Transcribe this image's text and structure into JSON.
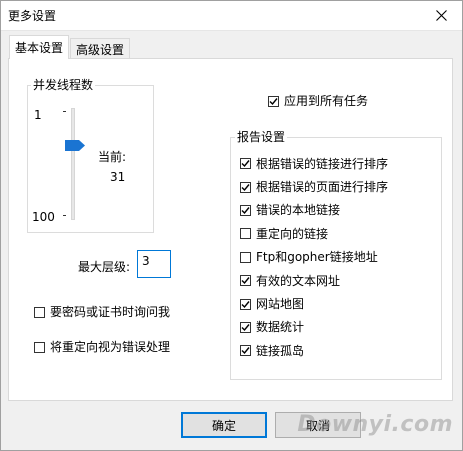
{
  "window": {
    "title": "更多设置"
  },
  "tabs": [
    {
      "label": "基本设置",
      "active": true
    },
    {
      "label": "高级设置",
      "active": false
    }
  ],
  "threads": {
    "group_label": "并发线程数",
    "min_label": "1",
    "max_label": "100",
    "current_label": "当前:",
    "current_value": "31"
  },
  "max_depth": {
    "label": "最大层级:",
    "value": "3"
  },
  "left_options": [
    {
      "label": "要密码或证书时询问我",
      "checked": false
    },
    {
      "label": "将重定向视为错误处理",
      "checked": false
    }
  ],
  "apply_all": {
    "label": "应用到所有任务",
    "checked": true
  },
  "report": {
    "group_label": "报告设置",
    "items": [
      {
        "label": "根据错误的链接进行排序",
        "checked": true
      },
      {
        "label": "根据错误的页面进行排序",
        "checked": true
      },
      {
        "label": "错误的本地链接",
        "checked": true
      },
      {
        "label": "重定向的链接",
        "checked": false
      },
      {
        "label": "Ftp和gopher链接地址",
        "checked": false
      },
      {
        "label": "有效的文本网址",
        "checked": true
      },
      {
        "label": "网站地图",
        "checked": true
      },
      {
        "label": "数据统计",
        "checked": true
      },
      {
        "label": "链接孤岛",
        "checked": true
      }
    ]
  },
  "buttons": {
    "ok": "确定",
    "cancel": "取消"
  },
  "watermark": "Downyi.com",
  "colors": {
    "accent": "#0078d7",
    "slider_thumb": "#1a74d2"
  }
}
